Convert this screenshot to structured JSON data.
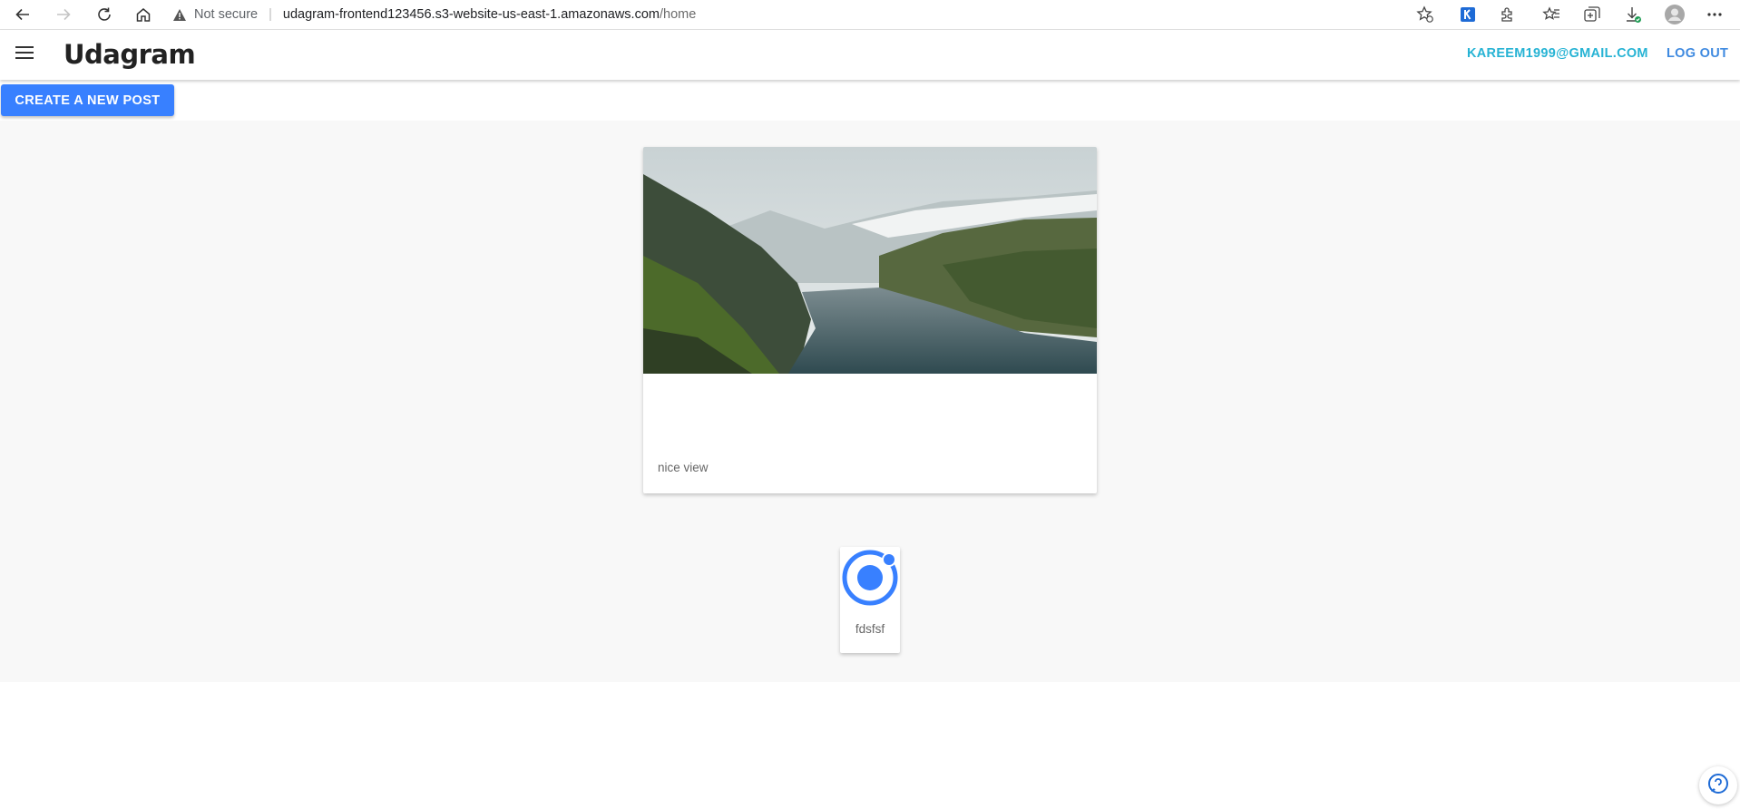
{
  "browser": {
    "security_label": "Not secure",
    "url_host": "udagram-frontend123456.s3-website-us-east-1.amazonaws.com",
    "url_path": "/home",
    "icons": [
      "back-icon",
      "forward-icon",
      "reload-icon",
      "home-icon",
      "warning-icon",
      "favorite-add-icon",
      "k-extension-icon",
      "extensions-icon",
      "favorites-icon",
      "collections-icon",
      "downloads-icon",
      "profile-icon",
      "more-icon"
    ]
  },
  "header": {
    "title": "Udagram",
    "email": "KAREEM1999@GMAIL.COM",
    "logout_label": "LOG OUT",
    "accent_email": "#26b3d4",
    "accent_logout": "#3f8ae0"
  },
  "actions": {
    "create_label": "CREATE A NEW POST",
    "create_color": "#3880ff"
  },
  "feed": {
    "posts": [
      {
        "caption": "nice view",
        "image": "fjord-landscape"
      },
      {
        "caption": "fdsfsf",
        "image": "ionic-logo"
      }
    ]
  }
}
